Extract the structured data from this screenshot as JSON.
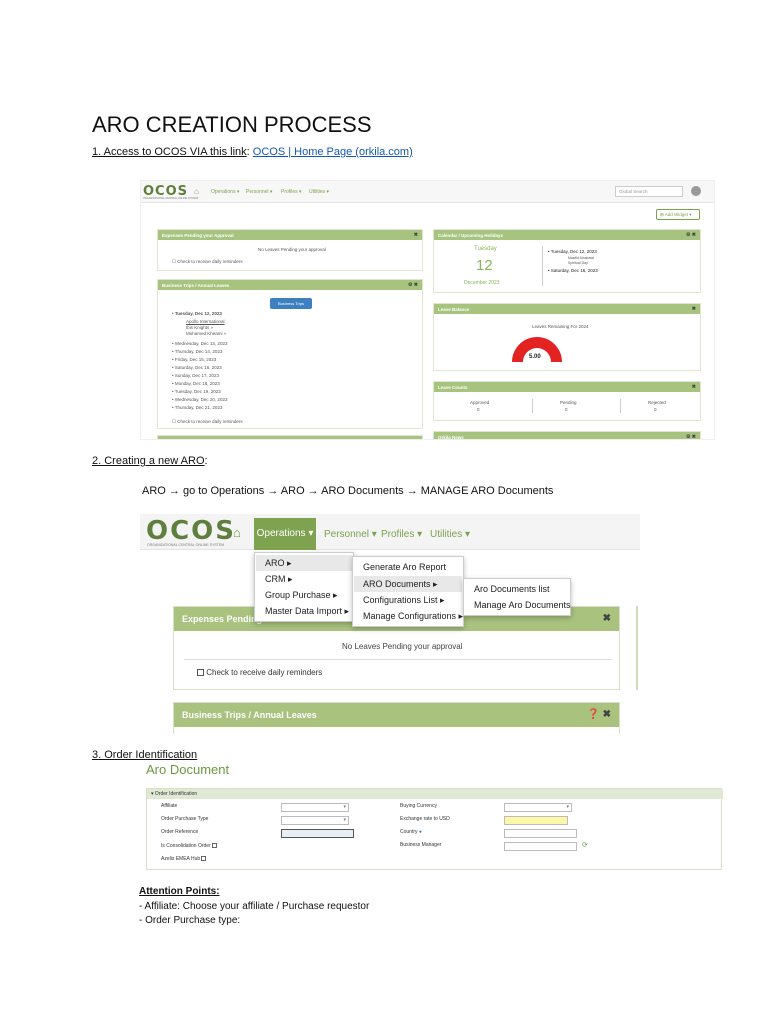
{
  "doc": {
    "title": "ARO CREATION PROCESS",
    "step1_prefix": "1. Access to OCOS VIA this link",
    "step1_colon": ": ",
    "step1_link": "OCOS | Home Page (orkila.com) ",
    "step2": "2. Creating a new ARO",
    "step2_colon": ":",
    "flow": "ARO → go to Operations →  ARO → ARO Documents → MANAGE ARO Documents",
    "step3": "3. Order Identification"
  },
  "shot1": {
    "logo": "OCOS",
    "logo_sub": "ORGANIZATIONAL CENTRAL ONLINE SYSTEM",
    "nav": [
      "Operations ▾",
      "Personnel ▾",
      "Profiles ▾",
      "Utilities ▾"
    ],
    "search_placeholder": "Global Search",
    "add_widget": "⊞ Add Widget ▾",
    "expenses": {
      "title": "Expenses Pending your Approval",
      "message": "No Leaves Pending your approval",
      "checkbox": "Check to receive daily reminders"
    },
    "trips": {
      "title": "Business Trips / Annual Leaves",
      "toggle": "Business Trips",
      "first_day": "Tuesday, Dec 12, 2023",
      "entries": [
        "Apollo International",
        "Ibis Knights »",
        "Mohamed Kheami »"
      ],
      "days": [
        "Wednesday, Dec 13, 2023",
        "Thursday, Dec 14, 2023",
        "Friday, Dec 15, 2023",
        "Saturday, Dec 16, 2023",
        "Sunday, Dec 17, 2023",
        "Monday, Dec 18, 2023",
        "Tuesday, Dec 19, 2023",
        "Wednesday, Dec 20, 2023",
        "Thursday, Dec 21, 2023"
      ],
      "checkbox": "Check to receive daily reminders"
    },
    "calendar": {
      "title": "Calendar / Upcoming Holidays",
      "weekday": "Tuesday",
      "day": "12",
      "month": "December 2023",
      "items": [
        "Tuesday, Dec 12, 2023",
        "Mawlid Alnabawi",
        "Spiritual Day",
        "Saturday, Dec 16, 2023"
      ]
    },
    "leave_balance": {
      "title": "Leave Balance",
      "subtitle": "Leaves Remaining For 2024",
      "value": "5.00"
    },
    "leave_counts": {
      "title": "Leave Counts",
      "labels": [
        "Approved",
        "Pending",
        "Rejected"
      ],
      "values": [
        "0",
        "0",
        "0"
      ]
    },
    "news": {
      "title": "Orkila News"
    }
  },
  "shot2": {
    "logo": "OCOS",
    "logo_sub": "ORGANIZATIONAL CENTRAL ONLINE SYSTEM",
    "nav_active": "Operations ▾",
    "nav": [
      "Personnel ▾",
      "Profiles ▾",
      "Utilities ▾"
    ],
    "menu1": [
      "ARO ▸",
      "CRM ▸",
      "Group Purchase ▸",
      "Master Data Import ▸"
    ],
    "menu2": [
      "Generate Aro Report",
      "ARO Documents ▸",
      "Configurations List ▸",
      "Manage Configurations ▸"
    ],
    "menu3": [
      "Aro Documents list",
      "Manage Aro Documents"
    ],
    "expenses_title": "Expenses Pending",
    "message": "No Leaves Pending your approval",
    "checkbox": "Check to receive daily reminders",
    "trips_title": "Business Trips / Annual Leaves"
  },
  "shot3": {
    "title": "Aro Document",
    "section": "▾  Order Identification",
    "left_labels": [
      "Affiliate",
      "Order Purchase Type",
      "Order Reference",
      "Is Consolidation Order",
      "Azelis EMEA Hub"
    ],
    "right_labels": [
      "Buying Currency",
      "Exchange rate to USD",
      "Country",
      "Business Manager"
    ]
  },
  "attention": {
    "title": "Attention Points:",
    "lines": [
      "- Affiliate: Choose your affiliate / Purchase requestor",
      "- Order Purchase type:"
    ]
  },
  "colors": {
    "ocos_green": "#7ea24f",
    "link_blue": "#1558b0",
    "gauge_red": "#e32222"
  }
}
